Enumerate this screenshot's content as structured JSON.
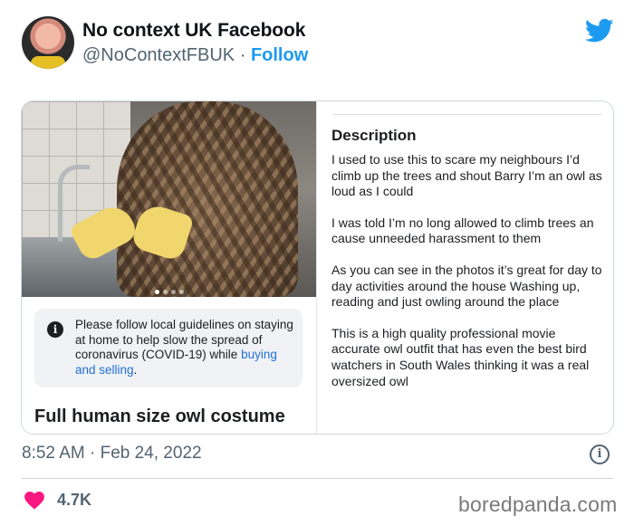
{
  "tweet": {
    "author_name": "No context UK Facebook",
    "author_handle": "@NoContextFBUK",
    "separator": "·",
    "follow_label": "Follow",
    "timestamp": "8:52 AM · Feb 24, 2022",
    "likes": "4.7K"
  },
  "listing": {
    "notice_text_1": "Please follow local guidelines on staying at home to help slow the spread of coronavirus (COVID-19) while ",
    "notice_link": "buying and selling",
    "notice_text_2": ".",
    "title": "Full human size owl costume",
    "description_heading": "Description",
    "description_paragraphs": [
      "I used to use this to scare my neighbours I’d climb up the trees and shout Barry I’m an owl as loud as I could",
      "I was told I’m no long allowed to climb trees an cause unneeded harassment to them",
      "As you can see in the photos it’s great for day to day activities around the house Washing up, reading and just owling around the place",
      "This is a high quality professional movie accurate owl outfit that has even the best bird watchers in South Wales thinking it was a real oversized owl"
    ]
  },
  "watermark": "boredpanda.com",
  "colors": {
    "twitter_blue": "#1d9bf0",
    "like_pink": "#f91880",
    "muted_text": "#536471"
  },
  "icons": [
    "twitter-bird-icon",
    "info-icon",
    "info-circle-icon",
    "heart-icon"
  ]
}
